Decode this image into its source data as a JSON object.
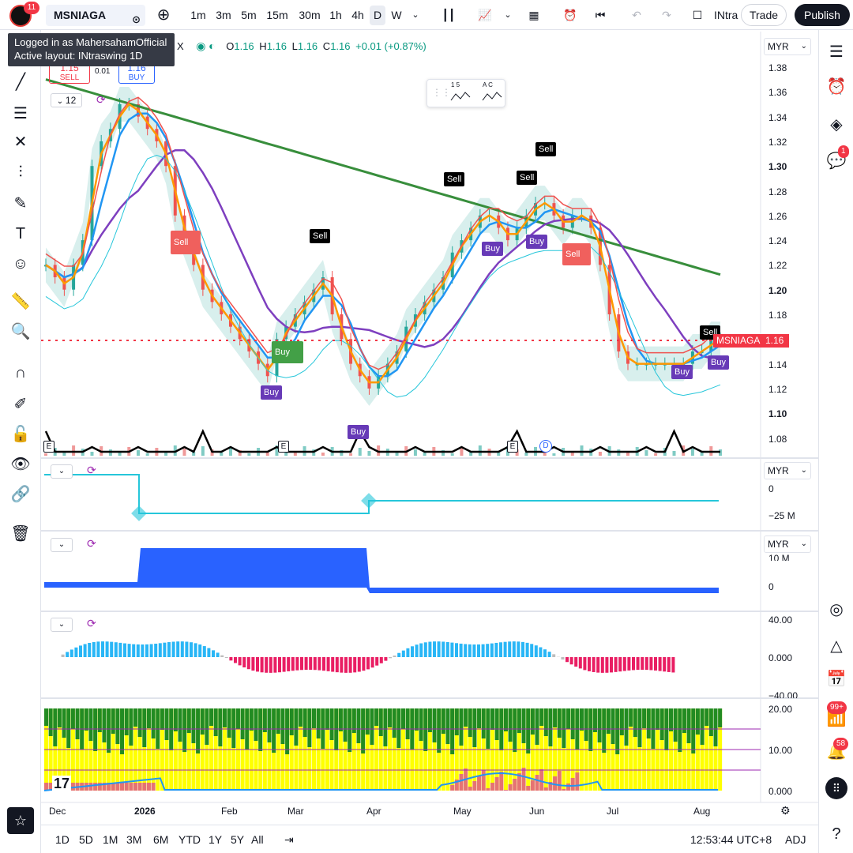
{
  "header": {
    "logo_badge": "11",
    "symbol": "MSNIAGA",
    "timeframes": [
      "1m",
      "3m",
      "5m",
      "15m",
      "30m",
      "1h",
      "4h",
      "D",
      "W"
    ],
    "active_timeframe": "D",
    "layout_name": "INtra",
    "trade_label": "Trade",
    "publish_label": "Publish"
  },
  "tooltip": {
    "line1": "Logged in as MahersahamOfficial",
    "line2": "Active layout: INtraswing 1D"
  },
  "legend": {
    "x_char": "X",
    "o_label": "O",
    "o_value": "1.16",
    "h_label": "H",
    "h_value": "1.16",
    "l_label": "L",
    "l_value": "1.16",
    "c_label": "C",
    "c_value": "1.16",
    "change": "+0.01 (+0.87%)",
    "sell_price": "1.15",
    "sell_label": "SELL",
    "spread": "0.01",
    "buy_price": "1.16",
    "buy_label": "BUY",
    "indicator_count": "12"
  },
  "toolbar_widget": {
    "left_label": "1 5",
    "right_label": "A C"
  },
  "price_axis": {
    "currency": "MYR",
    "labels": [
      "1.38",
      "1.36",
      "1.34",
      "1.32",
      "1.30",
      "1.28",
      "1.26",
      "1.24",
      "1.22",
      "1.20",
      "1.18",
      "1.16",
      "1.14",
      "1.12",
      "1.10",
      "1.08"
    ],
    "current_symbol": "MSNIAGA",
    "current_price": "1.16"
  },
  "pane2_axis": {
    "currency": "MYR",
    "labels": [
      "0",
      "−25 M"
    ]
  },
  "pane3_axis": {
    "currency": "MYR",
    "labels": [
      "10 M",
      "0"
    ]
  },
  "pane4_axis": {
    "labels": [
      "40.00",
      "0.000",
      "−40.00"
    ]
  },
  "pane5_axis": {
    "labels": [
      "20.00",
      "10.00",
      "0.000"
    ]
  },
  "signals": {
    "sell": "Sell",
    "buy": "Buy",
    "earnings": "E",
    "dividend": "D"
  },
  "x_axis": {
    "labels": [
      "Dec",
      "2026",
      "Feb",
      "Mar",
      "Apr",
      "May",
      "Jun",
      "Jul",
      "Aug"
    ]
  },
  "bottom_bar": {
    "ranges": [
      "1D",
      "5D",
      "1M",
      "3M",
      "6M",
      "YTD",
      "1Y",
      "5Y",
      "All"
    ],
    "time": "12:53:44 UTC+8",
    "adj": "ADJ"
  },
  "right_badges": {
    "chat": "1",
    "ideas": "99+",
    "notifications": "58"
  },
  "colors": {
    "up": "#26a69a",
    "down": "#ef5350",
    "purple": "#7e3fbf",
    "blue": "#2196f3",
    "orange": "#ff9800",
    "green": "#388e3c",
    "accent_red": "#f23645"
  }
}
